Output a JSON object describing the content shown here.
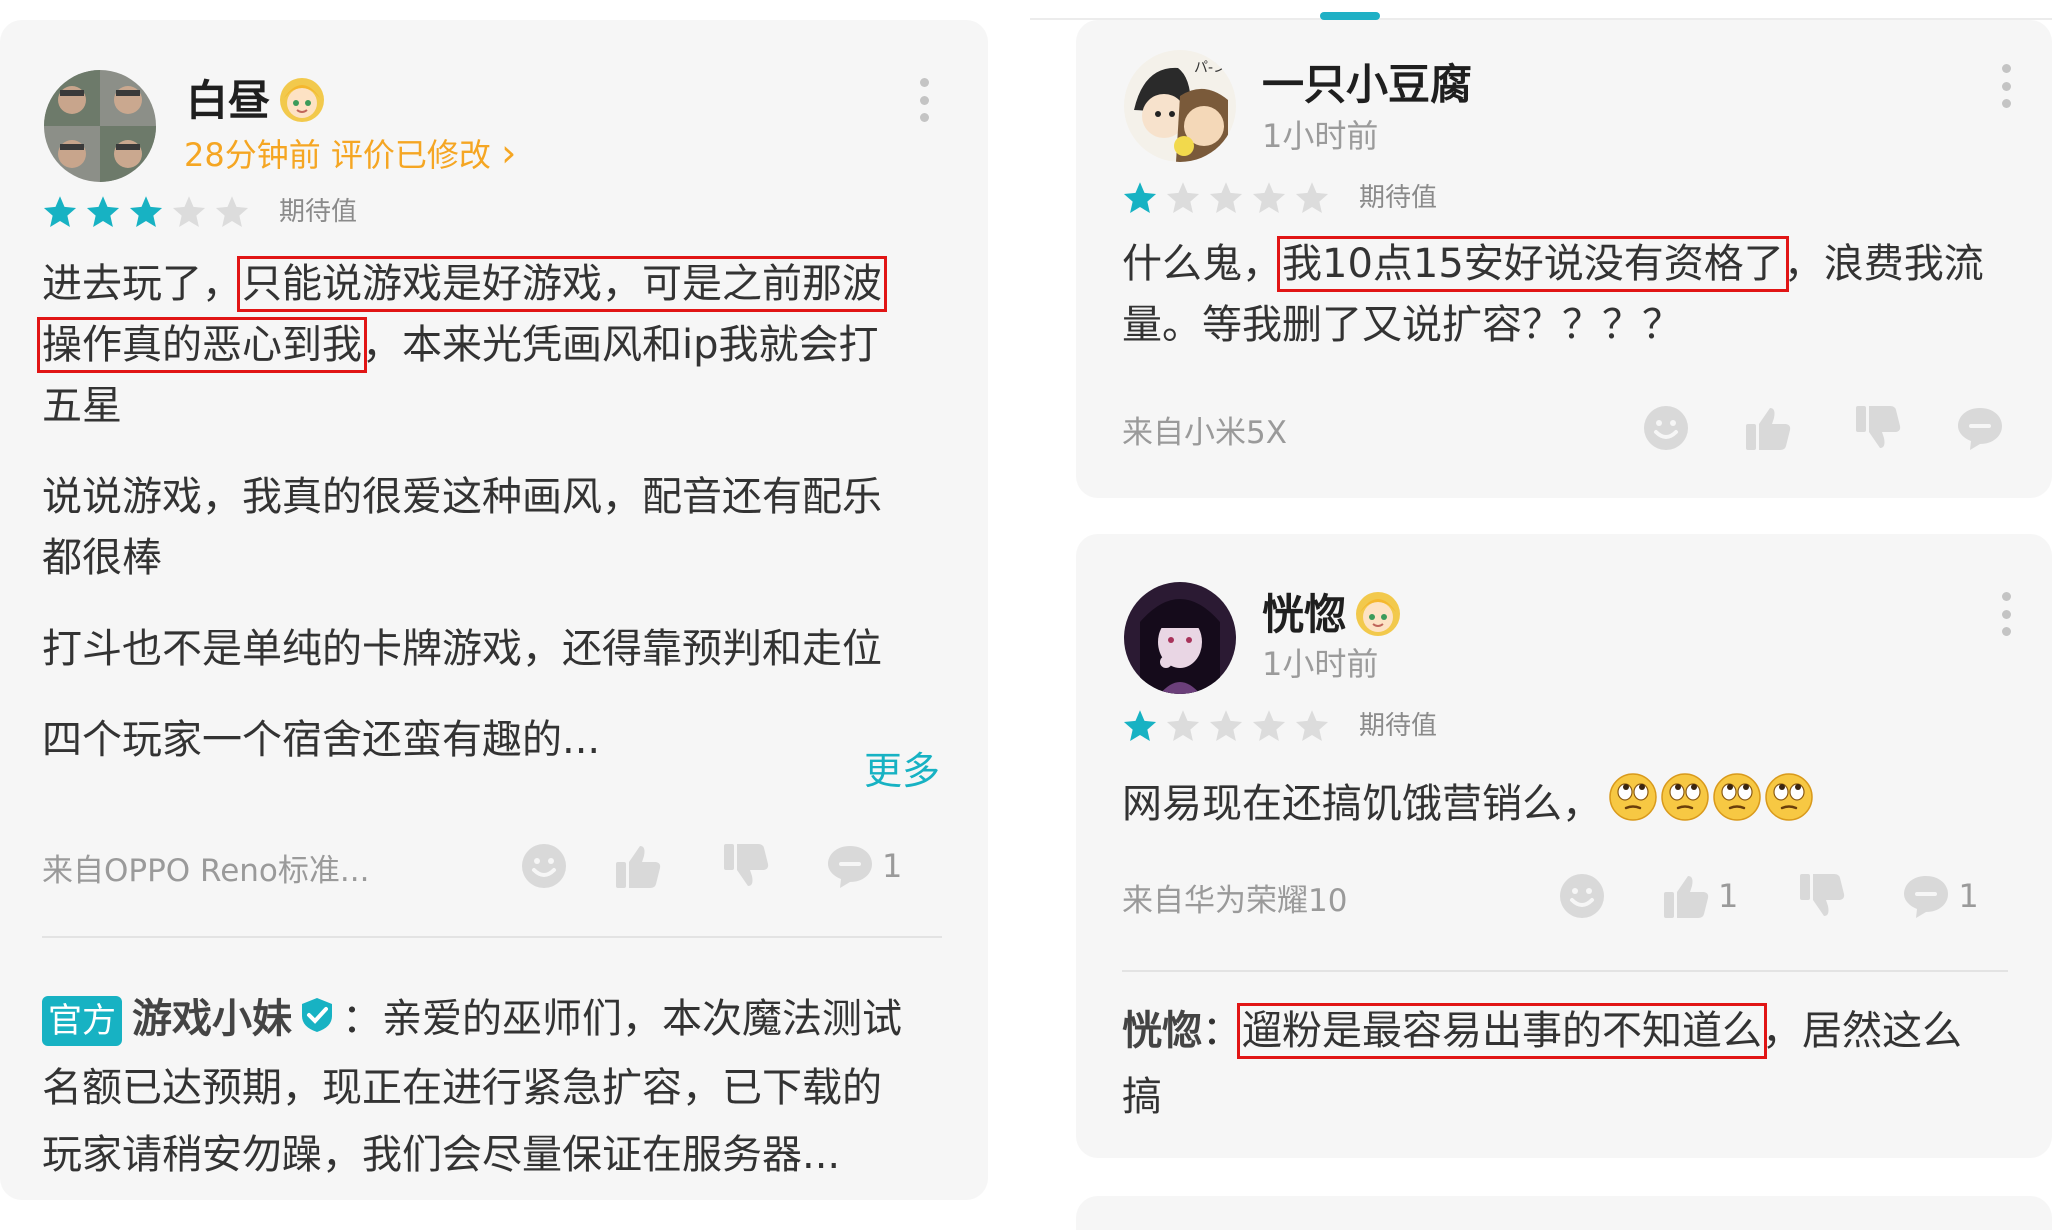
{
  "colors": {
    "accent": "#17b2c3",
    "star_filled": "#17b2c3",
    "star_empty": "#dcdcdc",
    "highlight": "#e11515",
    "time_orange": "#f5a623"
  },
  "reviews": [
    {
      "username": "白昼",
      "time": "28分钟前 评价已修改",
      "edited_chevron": "›",
      "rating": 3,
      "rating_max": 5,
      "rating_label": "期待值",
      "body": {
        "l1_pre": "进去玩了，",
        "l1_hl": "只能说游戏是好游戏，可是之前那波",
        "l2_hl": "操作真的恶心到我",
        "l2_post": "，本来光凭画风和ip我就会打",
        "l3": "五星",
        "l4": "说说游戏，我真的很爱这种画风，配音还有配乐",
        "l5": "都很棒",
        "l6": "打斗也不是单纯的卡牌游戏，还得靠预判和走位",
        "l7": "四个玩家一个宿舍还蛮有趣的..."
      },
      "more_label": "更多",
      "device": "来自OPPO Reno标准...",
      "counts": {
        "like": "",
        "reply": "1"
      },
      "official_reply": {
        "tag": "官方",
        "name": "游戏小妹",
        "l1": "：亲爱的巫师们，本次魔法测试",
        "l2": "名额已达预期，现正在进行紧急扩容，已下载的",
        "l3": "玩家请稍安勿躁，我们会尽量保证在服务器..."
      }
    },
    {
      "username": "一只小豆腐",
      "time": "1小时前",
      "rating": 1,
      "rating_max": 5,
      "rating_label": "期待值",
      "body": {
        "l1_pre": "什么鬼，",
        "l1_hl": "我10点15安好说没有资格了",
        "l1_post": "，浪费我流",
        "l2": "量。等我删了又说扩容？？？？"
      },
      "device": "来自小米5X",
      "counts": {
        "like": "",
        "reply": ""
      }
    },
    {
      "username": "恍惚",
      "time": "1小时前",
      "rating": 1,
      "rating_max": 5,
      "rating_label": "期待值",
      "body": {
        "l1": "网易现在还搞饥饿营销么，"
      },
      "emoji_count": 4,
      "device": "来自华为荣耀10",
      "counts": {
        "like": "1",
        "reply": "1"
      },
      "reply": {
        "name": "恍惚",
        "sep": "：",
        "hl": "遛粉是最容易出事的不知道么",
        "post": "，居然这么",
        "l2": "搞"
      }
    }
  ],
  "icons": [
    "emoji-reaction-icon",
    "thumbs-up-icon",
    "thumbs-down-icon",
    "comment-icon",
    "kebab-menu-icon",
    "verified-icon",
    "star-icon",
    "rolling-eyes-emoji"
  ]
}
